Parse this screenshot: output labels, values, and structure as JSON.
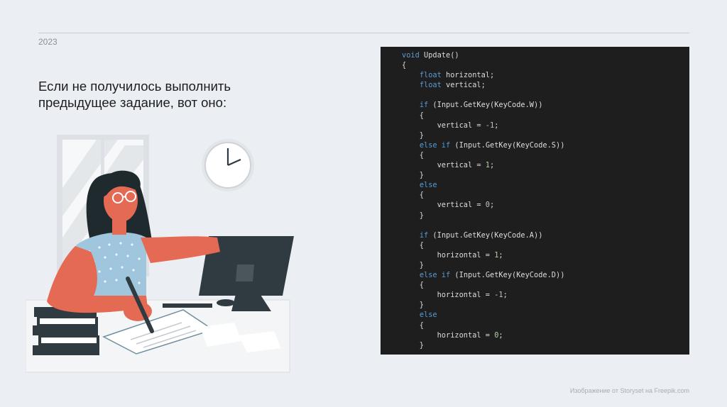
{
  "slide": {
    "year": "2023",
    "heading_lines": [
      "Если не получилось выполнить",
      "предыдущее задание, вот оно:"
    ],
    "credit": "Изображение от Storyset на Freepik.com"
  },
  "colors": {
    "background": "#ebeef2",
    "code_background": "#1e1e1e",
    "keyword": "#569cd6",
    "number": "#b5cea8",
    "text": "#dcdcdc",
    "skin": "#e46a53",
    "monitor": "#2f3b40"
  },
  "code": {
    "lines": [
      [
        {
          "t": "void ",
          "k": "kw"
        },
        {
          "t": "Update()",
          "k": ""
        }
      ],
      [
        {
          "t": "{",
          "k": ""
        }
      ],
      [
        {
          "t": "    ",
          "k": ""
        },
        {
          "t": "float ",
          "k": "kw"
        },
        {
          "t": "horizontal;",
          "k": ""
        }
      ],
      [
        {
          "t": "    ",
          "k": ""
        },
        {
          "t": "float ",
          "k": "kw"
        },
        {
          "t": "vertical;",
          "k": ""
        }
      ],
      [
        {
          "t": "",
          "k": ""
        }
      ],
      [
        {
          "t": "    ",
          "k": ""
        },
        {
          "t": "if ",
          "k": "kw"
        },
        {
          "t": "(Input.GetKey(KeyCode.W))",
          "k": ""
        }
      ],
      [
        {
          "t": "    {",
          "k": ""
        }
      ],
      [
        {
          "t": "        vertical = ",
          "k": ""
        },
        {
          "t": "-1",
          "k": "num"
        },
        {
          "t": ";",
          "k": ""
        }
      ],
      [
        {
          "t": "    }",
          "k": ""
        }
      ],
      [
        {
          "t": "    ",
          "k": ""
        },
        {
          "t": "else if ",
          "k": "kw"
        },
        {
          "t": "(Input.GetKey(KeyCode.S))",
          "k": ""
        }
      ],
      [
        {
          "t": "    {",
          "k": ""
        }
      ],
      [
        {
          "t": "        vertical = ",
          "k": ""
        },
        {
          "t": "1",
          "k": "num"
        },
        {
          "t": ";",
          "k": ""
        }
      ],
      [
        {
          "t": "    }",
          "k": ""
        }
      ],
      [
        {
          "t": "    ",
          "k": ""
        },
        {
          "t": "else",
          "k": "kw"
        }
      ],
      [
        {
          "t": "    {",
          "k": ""
        }
      ],
      [
        {
          "t": "        vertical = ",
          "k": ""
        },
        {
          "t": "0",
          "k": "num"
        },
        {
          "t": ";",
          "k": ""
        }
      ],
      [
        {
          "t": "    }",
          "k": ""
        }
      ],
      [
        {
          "t": "",
          "k": ""
        }
      ],
      [
        {
          "t": "    ",
          "k": ""
        },
        {
          "t": "if ",
          "k": "kw"
        },
        {
          "t": "(Input.GetKey(KeyCode.A))",
          "k": ""
        }
      ],
      [
        {
          "t": "    {",
          "k": ""
        }
      ],
      [
        {
          "t": "        horizontal = ",
          "k": ""
        },
        {
          "t": "1",
          "k": "num"
        },
        {
          "t": ";",
          "k": ""
        }
      ],
      [
        {
          "t": "    }",
          "k": ""
        }
      ],
      [
        {
          "t": "    ",
          "k": ""
        },
        {
          "t": "else if ",
          "k": "kw"
        },
        {
          "t": "(Input.GetKey(KeyCode.D))",
          "k": ""
        }
      ],
      [
        {
          "t": "    {",
          "k": ""
        }
      ],
      [
        {
          "t": "        horizontal = ",
          "k": ""
        },
        {
          "t": "-1",
          "k": "num"
        },
        {
          "t": ";",
          "k": ""
        }
      ],
      [
        {
          "t": "    }",
          "k": ""
        }
      ],
      [
        {
          "t": "    ",
          "k": ""
        },
        {
          "t": "else",
          "k": "kw"
        }
      ],
      [
        {
          "t": "    {",
          "k": ""
        }
      ],
      [
        {
          "t": "        horizontal = ",
          "k": ""
        },
        {
          "t": "0",
          "k": "num"
        },
        {
          "t": ";",
          "k": ""
        }
      ],
      [
        {
          "t": "    }",
          "k": ""
        }
      ]
    ]
  },
  "illustration": {
    "subject": "woman-at-computer",
    "icons": [
      "window-icon",
      "clock-icon",
      "monitor-icon",
      "books-icon",
      "pen-icon",
      "paper-icon"
    ]
  }
}
